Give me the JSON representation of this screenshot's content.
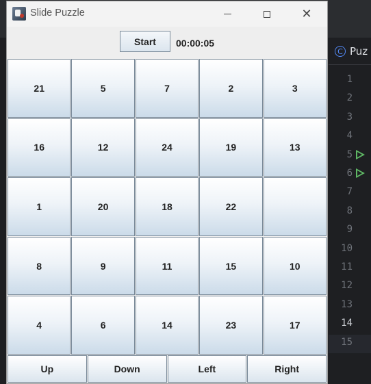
{
  "window": {
    "title": "Slide Puzzle",
    "icons": {
      "app": "puzzle-app-icon",
      "minimize": "minimize-icon",
      "maximize": "maximize-icon",
      "close": "close-icon"
    }
  },
  "toolbar": {
    "start_label": "Start",
    "timer": "00:00:05"
  },
  "board": {
    "tiles": [
      "21",
      "5",
      "7",
      "2",
      "3",
      "16",
      "12",
      "24",
      "19",
      "13",
      "1",
      "20",
      "18",
      "22",
      "",
      "8",
      "9",
      "11",
      "15",
      "10",
      "4",
      "6",
      "14",
      "23",
      "17"
    ]
  },
  "controls": {
    "up": "Up",
    "down": "Down",
    "left": "Left",
    "right": "Right"
  },
  "ide": {
    "tab_label": "Puz",
    "tab_icon": "class-c-icon",
    "line_numbers": [
      "1",
      "2",
      "3",
      "4",
      "5",
      "6",
      "7",
      "8",
      "9",
      "10",
      "11",
      "12",
      "13",
      "14",
      "15"
    ],
    "current_line": "14"
  }
}
